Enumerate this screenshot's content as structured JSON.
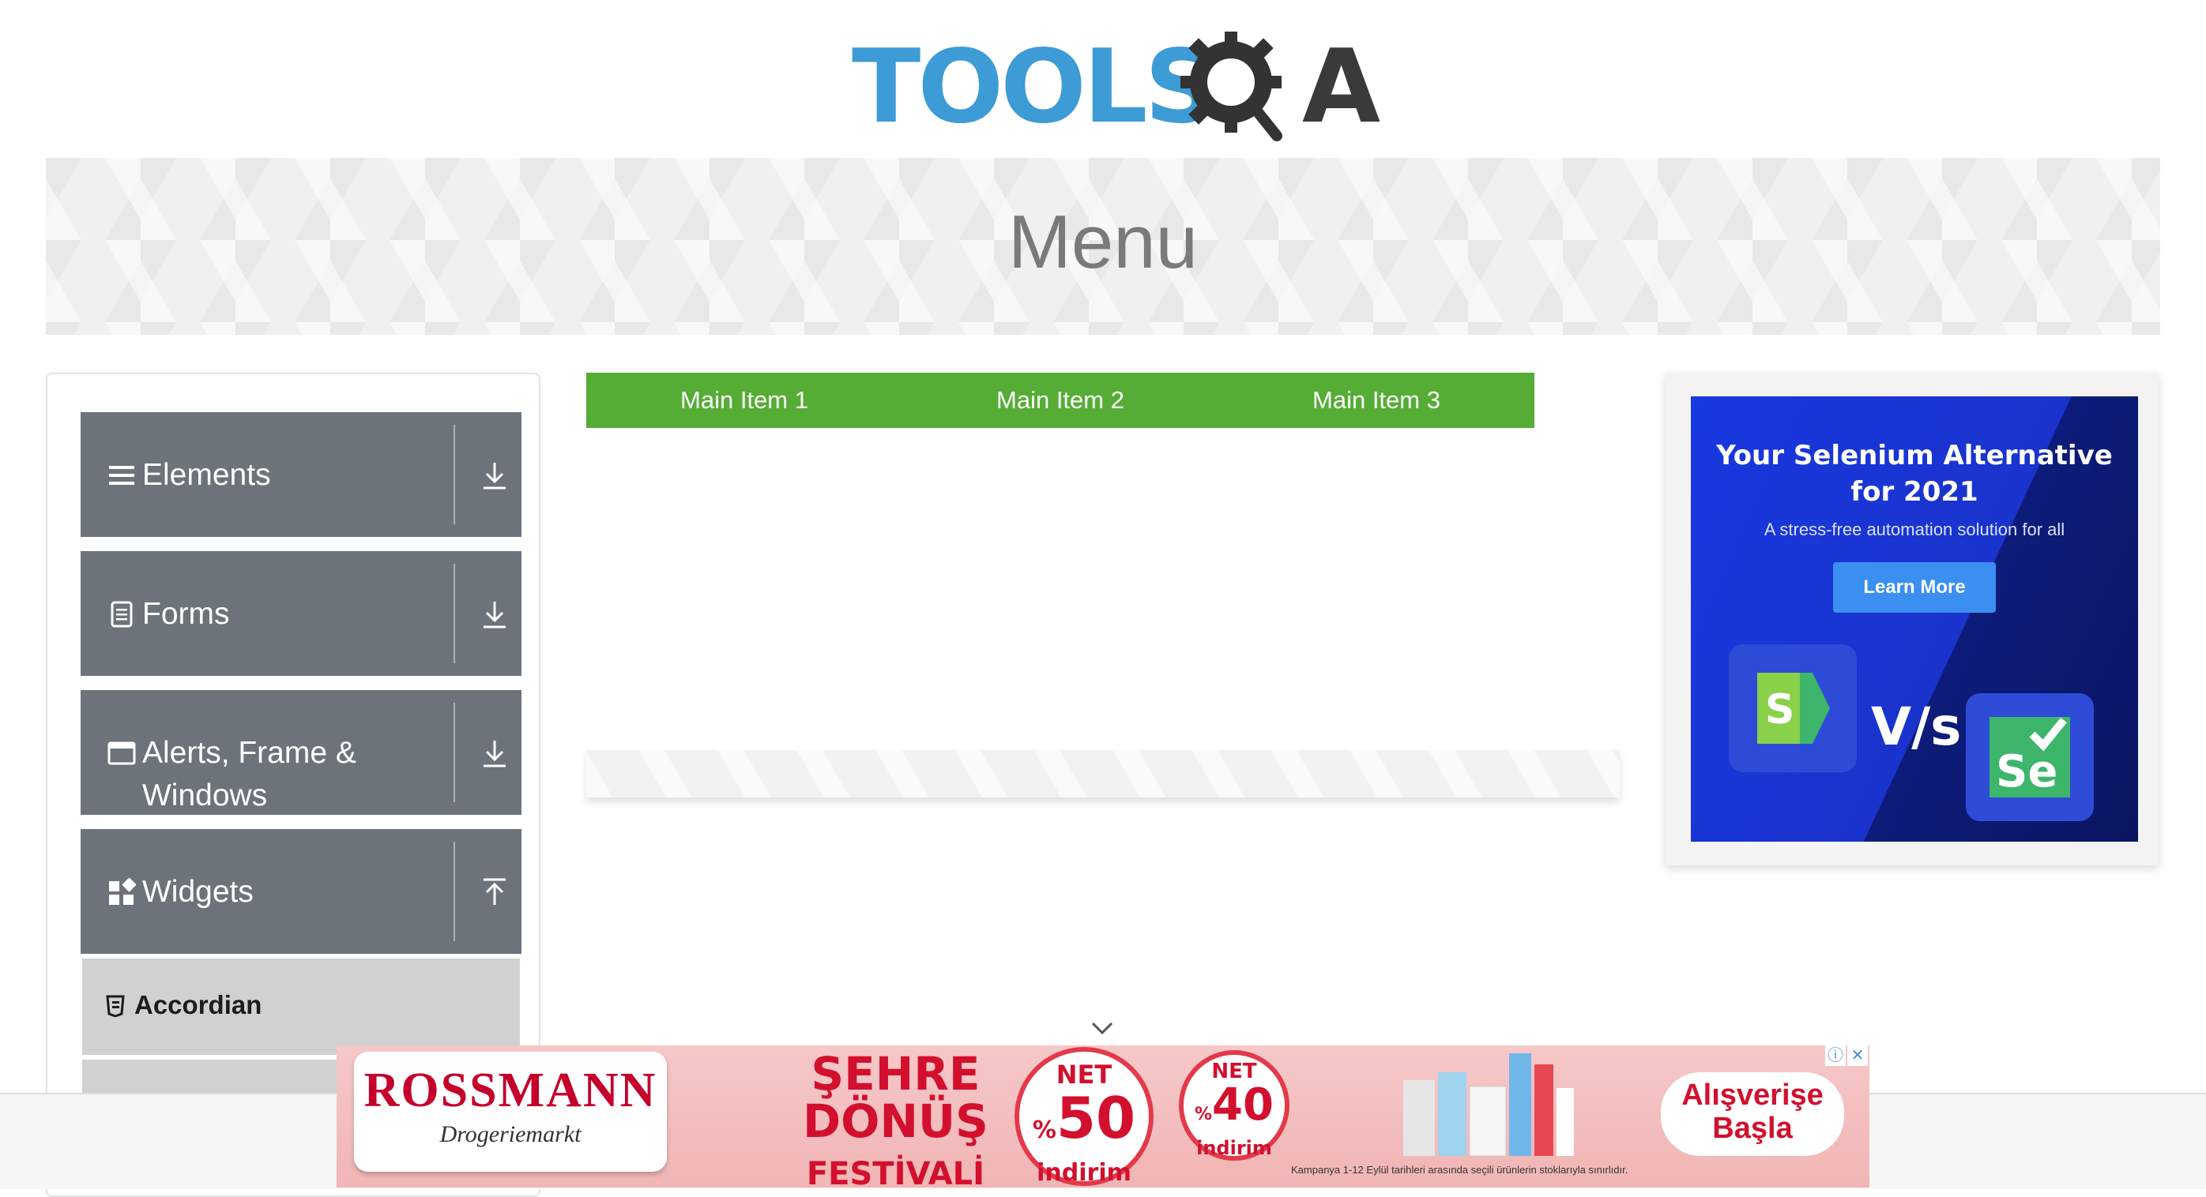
{
  "header": {
    "logo_left": "TOOLS",
    "logo_right": "A",
    "logo_mark": "Q"
  },
  "banner": {
    "title": "Menu"
  },
  "sidebar": {
    "groups": [
      {
        "label": "Elements",
        "icon": "list-icon",
        "arrow": "download-arrow-icon"
      },
      {
        "label": "Forms",
        "icon": "document-icon",
        "arrow": "download-arrow-icon"
      },
      {
        "label": "Alerts, Frame &",
        "label2": "Windows",
        "icon": "window-icon",
        "arrow": "download-arrow-icon"
      },
      {
        "label": "Widgets",
        "icon": "widgets-icon",
        "arrow": "upload-arrow-icon"
      }
    ],
    "active_item": {
      "label": "Accordian",
      "icon": "html5-icon"
    }
  },
  "menu": {
    "items": [
      "Main Item 1",
      "Main Item 2",
      "Main Item 3"
    ],
    "accent": "#55ad35"
  },
  "side_ad": {
    "title_line1": "Your Selenium Alternative",
    "title_line2": "for 2021",
    "subtitle": "A stress-free automation solution for all",
    "button": "Learn More",
    "vs": "V/s",
    "left_tile": "S",
    "right_tile": "Se"
  },
  "bottom_ad": {
    "brand": "ROSSMANN",
    "brand_sub": "Drogeriemarkt",
    "festival": [
      "ŞEHRE",
      "DÖNÜŞ",
      "FESTİVALİ"
    ],
    "offer1": {
      "top": "NET",
      "pct": "%",
      "value": "50",
      "bottom": "indirim"
    },
    "offer2": {
      "top": "NET",
      "pct": "%",
      "value": "40",
      "bottom": "indirim"
    },
    "cta_line1": "Alışverişe",
    "cta_line2": "Başla",
    "fine_print": "Kampanya 1-12 Eylül tarihleri arasında seçili ürünlerin stoklarıyla sınırlıdır."
  }
}
